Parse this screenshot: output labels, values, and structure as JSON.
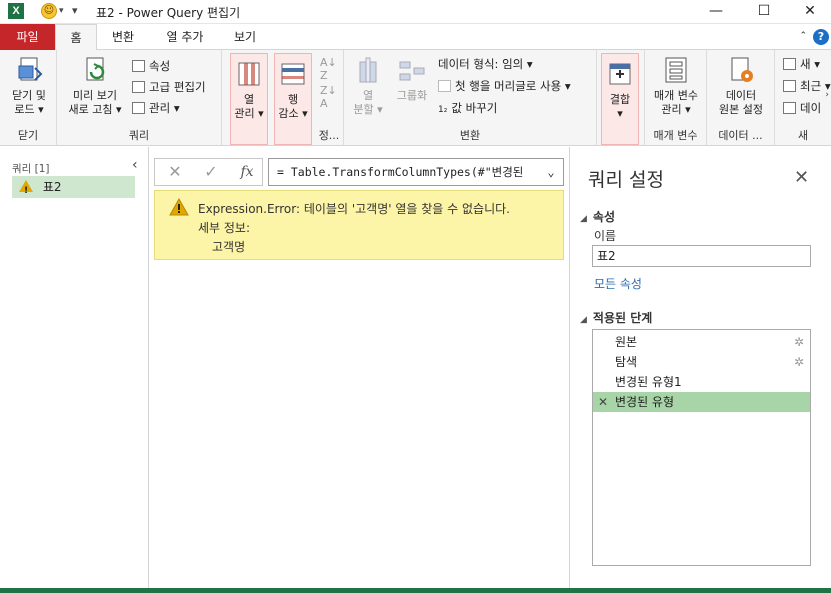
{
  "titlebar": {
    "app_icon": "X",
    "title": "표2 - Power Query 편집기",
    "undo_caret": "▾",
    "menu_caret": "▾"
  },
  "window_controls": {
    "minimize": "—",
    "maximize": "☐",
    "close": "✕"
  },
  "tabs": [
    {
      "label": "파일"
    },
    {
      "label": "홈"
    },
    {
      "label": "변환"
    },
    {
      "label": "열 추가"
    },
    {
      "label": "보기"
    }
  ],
  "help_label": "?",
  "ribbon": {
    "close_group": {
      "btn": "닫기 및\n로드 ▾",
      "label": "닫기"
    },
    "query_group": {
      "refresh": "미리 보기\n새로 고침 ▾",
      "properties": "속성",
      "advanced_editor": "고급 편집기",
      "manage": "관리 ▾",
      "label": "쿼리"
    },
    "columns": {
      "btn": "열\n관리 ▾"
    },
    "rows": {
      "btn": "행\n감소 ▾"
    },
    "sort": {
      "label": "정..."
    },
    "transform_group": {
      "split": "열\n분할 ▾",
      "group": "그룹화",
      "datatype": "데이터 형식: 임의 ▾",
      "first_row": "첫 행을 머리글로 사용 ▾",
      "replace": "값 바꾸기",
      "label": "변환"
    },
    "combine": {
      "btn": "결합\n▾"
    },
    "params_group": {
      "btn": "매개 변수\n관리 ▾",
      "label": "매개 변수"
    },
    "datasource_group": {
      "btn": "데이터\n원본 설정",
      "label": "데이터 ..."
    },
    "new_group": {
      "new": "새 ▾",
      "recent": "최근 ▾",
      "data": "데이",
      "label": "새"
    }
  },
  "queries_pane": {
    "header": "쿼리 [1]",
    "collapse": "‹",
    "item": "표2"
  },
  "formula": {
    "cancel": "✕",
    "commit": "✓",
    "fx": "fx",
    "text": "= Table.TransformColumnTypes(#\"변경된",
    "dropdown": "⌄"
  },
  "error": {
    "message": "Expression.Error: 테이블의 '고객명' 열을 찾을 수 없습니다.",
    "details_label": "세부 정보:",
    "details_value": "고객명"
  },
  "query_settings": {
    "title": "쿼리 설정",
    "close": "✕",
    "properties_section": "속성",
    "name_label": "이름",
    "name_value": "표2",
    "all_properties": "모든 속성",
    "steps_section": "적용된 단계",
    "steps": [
      {
        "label": "원본",
        "has_gear": true
      },
      {
        "label": "탐색",
        "has_gear": true
      },
      {
        "label": "변경된 유형1",
        "has_gear": false
      },
      {
        "label": "변경된 유형",
        "has_gear": false,
        "selected": true
      }
    ]
  },
  "colors": {
    "file_tab": "#c5262a",
    "excel_green": "#217346",
    "selected_step": "#a8d5a8",
    "error_bg": "#fcf4a6"
  }
}
